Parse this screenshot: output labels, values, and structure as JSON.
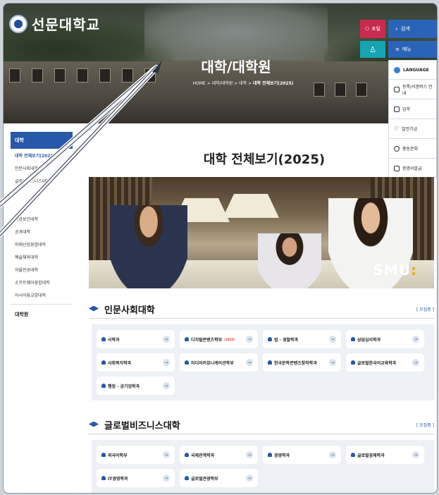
{
  "header": {
    "logo_text": "선문대학교",
    "hero_title": "대학/대학원",
    "breadcrumb": [
      "HOME",
      "대학/대학원",
      "대학",
      "대학 전체보기(2025)"
    ],
    "portal_label": "포털",
    "search_label": "검색",
    "menu_label": "메뉴"
  },
  "quick_menu": [
    {
      "label": "LANGUAGE",
      "icon": "globe-icon"
    },
    {
      "label": "등록/서증버스 안내",
      "icon": "bus-icon"
    },
    {
      "label": "입학",
      "icon": "school-icon"
    },
    {
      "label": "발전기금",
      "icon": "heart-icon"
    },
    {
      "label": "총동문회",
      "icon": "graduation-cap-icon"
    },
    {
      "label": "증명서발급",
      "icon": "print-icon"
    }
  ],
  "left_nav": {
    "title": "대학",
    "items": [
      "대학 전체보기(2025)",
      "인문사회대학",
      "글로벌비즈니스대학",
      "",
      "",
      "건강보건대학",
      "공과대학",
      "미래산업융합대학",
      "예술체육대학",
      "자율전공대학",
      "소프트웨어융합대학",
      "아시아융교양대학"
    ],
    "grad_label": "대학원"
  },
  "main": {
    "page_title": "대학 전체보기(2025)",
    "photo_brand": "SMU",
    "sections": [
      {
        "title": "인문사회대학",
        "more": "[ 모집중 ]",
        "items": [
          {
            "label": "사학과",
            "note": ""
          },
          {
            "label": "디지털콘텐츠학부",
            "note": "(2025)"
          },
          {
            "label": "법 · 경찰학과",
            "note": ""
          },
          {
            "label": "상담심리학과",
            "note": ""
          },
          {
            "label": "사회복지학과",
            "note": ""
          },
          {
            "label": "미디어커뮤니케이션학부",
            "note": ""
          },
          {
            "label": "한국문학콘텐츠창작학과",
            "note": ""
          },
          {
            "label": "글로벌한국어교육학과",
            "note": ""
          },
          {
            "label": "행정 · 공기업학과",
            "note": ""
          }
        ]
      },
      {
        "title": "글로벌비즈니스대학",
        "more": "[ 모집중 ]",
        "items": [
          {
            "label": "외국어학부",
            "note": ""
          },
          {
            "label": "국제관계학과",
            "note": ""
          },
          {
            "label": "경영학과",
            "note": ""
          },
          {
            "label": "글로벌경제학과",
            "note": ""
          },
          {
            "label": "IT경영학과",
            "note": ""
          },
          {
            "label": "글로벌관광학부",
            "note": ""
          }
        ]
      }
    ]
  },
  "colors": {
    "accent": "#2858a8",
    "portal": "#c92a4d",
    "teal": "#16a5b1"
  }
}
